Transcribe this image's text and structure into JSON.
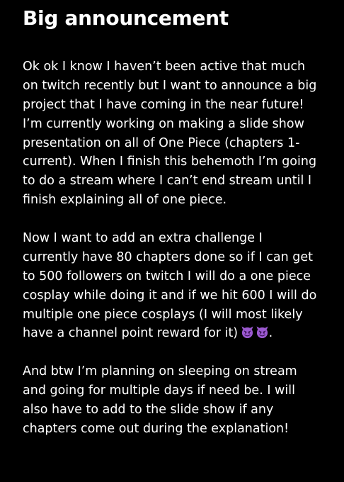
{
  "note": {
    "title": "Big announcement",
    "paragraphs": [
      {
        "lines": [
          "Ok ok I know I haven’t been active that much",
          "on twitch recently but I want to announce a big",
          "project that I have coming in the near future!",
          "I’m currently working on making a slide show",
          "presentation on all of One Piece (chapters 1-",
          "current). When I finish this behemoth I’m going",
          "to do a stream where I can’t end stream until I",
          "finish explaining all of one piece."
        ]
      },
      {
        "lines": [
          "Now I want to add an extra challenge I",
          "currently have 80 chapters done so if I can get",
          "to 500 followers on twitch I will do a one piece",
          "cosplay while doing it and if we hit 600 I will do",
          "multiple one piece cosplays (I will most likely"
        ],
        "last_line_text": "have a channel point reward for it)",
        "last_line_suffix": ".",
        "emoji": [
          "smiling-imp-emoji",
          "smiling-imp-emoji"
        ],
        "emoji_color": "#9b59d0"
      },
      {
        "lines": [
          "And btw I’m planning on sleeping on stream",
          "and going for multiple days if need be. I will",
          "also have to add to the slide show if any",
          "chapters come out during the explanation!"
        ]
      }
    ]
  },
  "colors": {
    "background": "#000000",
    "text": "#ffffff"
  }
}
